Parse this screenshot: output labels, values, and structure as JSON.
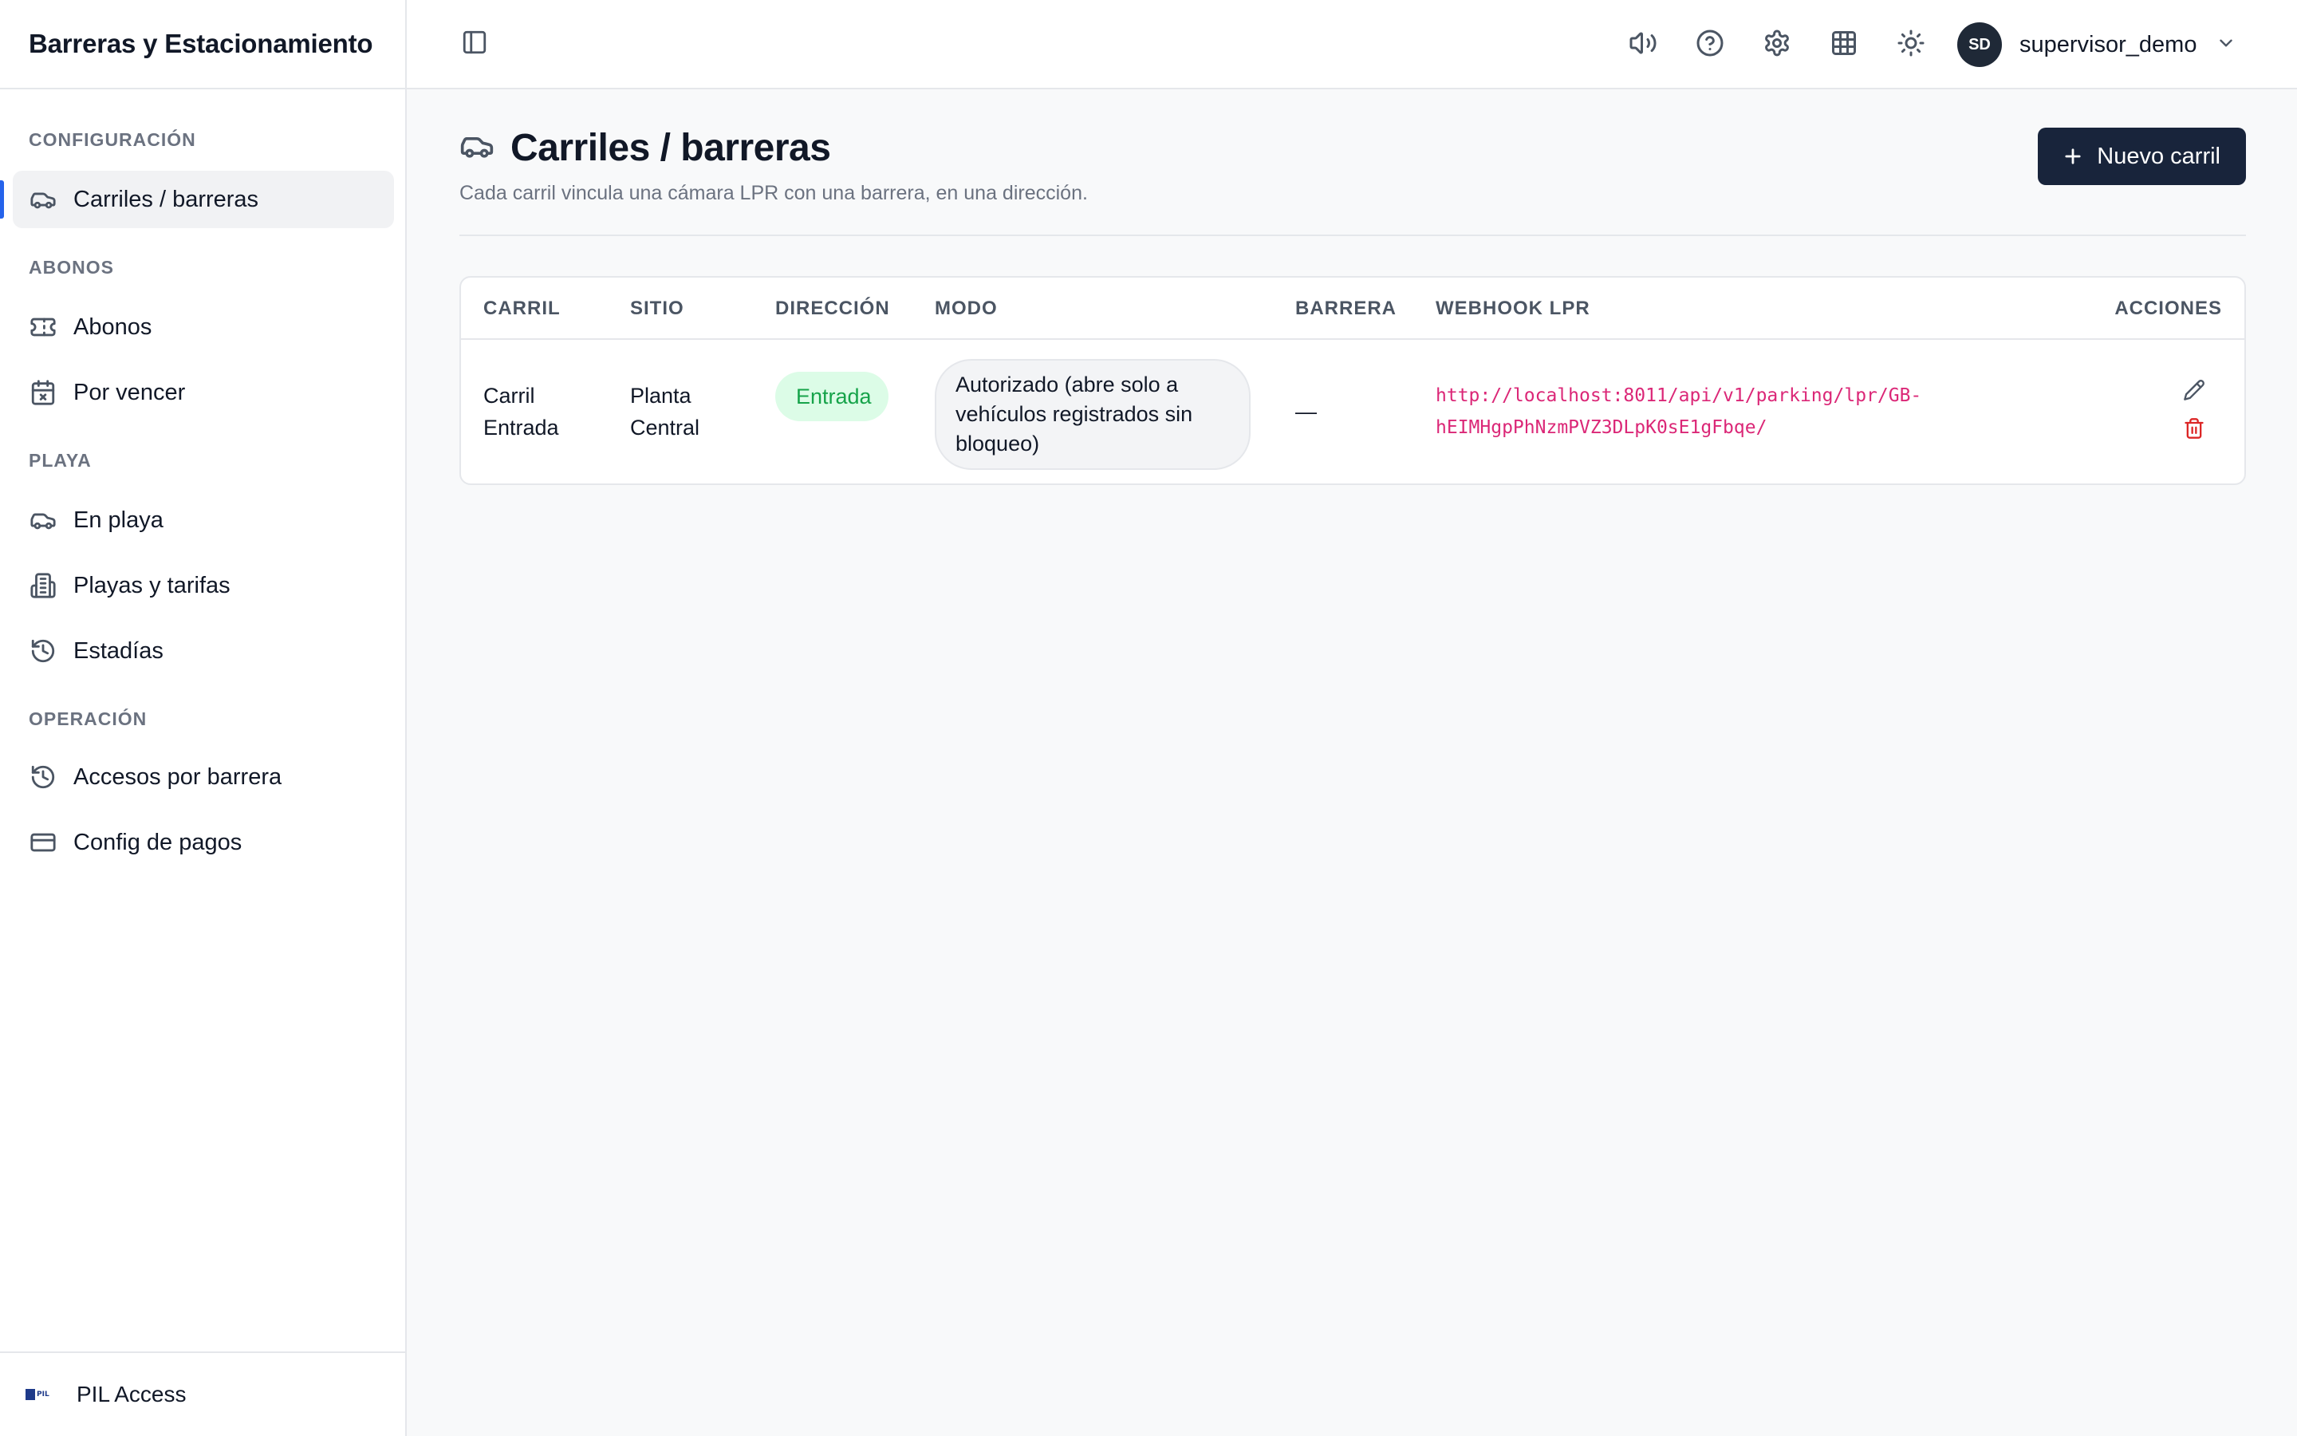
{
  "app": {
    "title": "Barreras y Estacionamiento"
  },
  "sidebar": {
    "sections": [
      {
        "label": "CONFIGURACIÓN",
        "items": [
          {
            "label": "Carriles / barreras",
            "icon": "car-icon",
            "active": true
          }
        ]
      },
      {
        "label": "ABONOS",
        "items": [
          {
            "label": "Abonos",
            "icon": "ticket-icon"
          },
          {
            "label": "Por vencer",
            "icon": "calendar-x-icon"
          }
        ]
      },
      {
        "label": "PLAYA",
        "items": [
          {
            "label": "En playa",
            "icon": "car-icon"
          },
          {
            "label": "Playas y tarifas",
            "icon": "building-icon"
          },
          {
            "label": "Estadías",
            "icon": "history-icon"
          }
        ]
      },
      {
        "label": "OPERACIÓN",
        "items": [
          {
            "label": "Accesos por barrera",
            "icon": "history-icon"
          },
          {
            "label": "Config de pagos",
            "icon": "credit-card-icon"
          }
        ]
      }
    ],
    "footer": {
      "label": "PIL Access",
      "logo_text": "PIL"
    }
  },
  "topbar": {
    "icons": [
      "sidebar-toggle-icon",
      "volume-icon",
      "help-icon",
      "settings-icon",
      "grid-icon",
      "sun-icon"
    ],
    "user": {
      "initials": "SD",
      "name": "supervisor_demo"
    }
  },
  "page": {
    "title": "Carriles / barreras",
    "subtitle": "Cada carril vincula una cámara LPR con una barrera, en una dirección.",
    "new_button": "Nuevo carril"
  },
  "table": {
    "columns": [
      "CARRIL",
      "SITIO",
      "DIRECCIÓN",
      "MODO",
      "BARRERA",
      "WEBHOOK LPR",
      "ACCIONES"
    ],
    "rows": [
      {
        "carril": "Carril Entrada",
        "sitio": "Planta Central",
        "direccion": "Entrada",
        "modo": "Autorizado (abre solo a vehículos registrados sin bloqueo)",
        "barrera": "—",
        "webhook": "http://localhost:8011/api/v1/parking/lpr/GB-hEIMHgpPhNzmPVZ3DLpK0sE1gFbqe/"
      }
    ]
  },
  "colors": {
    "accent": "#2563eb",
    "primary_button": "#18243b",
    "badge_green_bg": "#dcfce7",
    "badge_green_text": "#16a34a",
    "webhook_text": "#db2777",
    "delete_icon": "#dc2626"
  }
}
